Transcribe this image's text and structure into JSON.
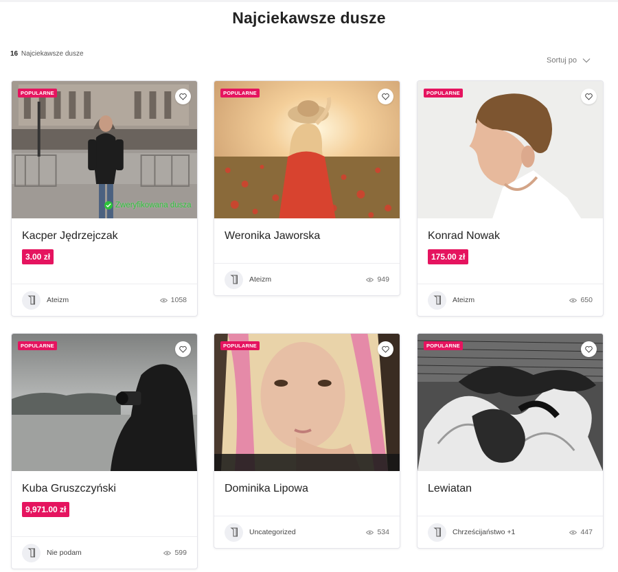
{
  "page": {
    "title": "Najciekawsze dusze",
    "count_value": "16",
    "count_label": "Najciekawsze dusze",
    "sort_label": "Sortuj po"
  },
  "colors": {
    "accent": "#e5145f",
    "verified": "#2cc23a"
  },
  "cards": [
    {
      "badge": "POPULARNE",
      "name": "Kacper Jędrzejczak",
      "price": "3.00 zł",
      "verified_label": "Zweryfikowana dusza",
      "category": "Ateizm",
      "views": "1058",
      "category_icon": "book-icon"
    },
    {
      "badge": "POPULARNE",
      "name": "Weronika Jaworska",
      "category": "Ateizm",
      "views": "949",
      "category_icon": "book-icon"
    },
    {
      "badge": "POPULARNE",
      "name": "Konrad Nowak",
      "price": "175.00 zł",
      "category": "Ateizm",
      "views": "650",
      "category_icon": "book-icon"
    },
    {
      "badge": "POPULARNE",
      "name": "Kuba Gruszczyński",
      "price": "9,971.00 zł",
      "category": "Nie podam",
      "views": "599",
      "category_icon": "book-icon"
    },
    {
      "badge": "POPULARNE",
      "name": "Dominika Lipowa",
      "category": "Uncategorized",
      "views": "534",
      "category_icon": "book-icon"
    },
    {
      "badge": "POPULARNE",
      "name": "Lewiatan",
      "category": "Chrześcijaństwo +1",
      "views": "447",
      "category_icon": "book-icon"
    }
  ]
}
